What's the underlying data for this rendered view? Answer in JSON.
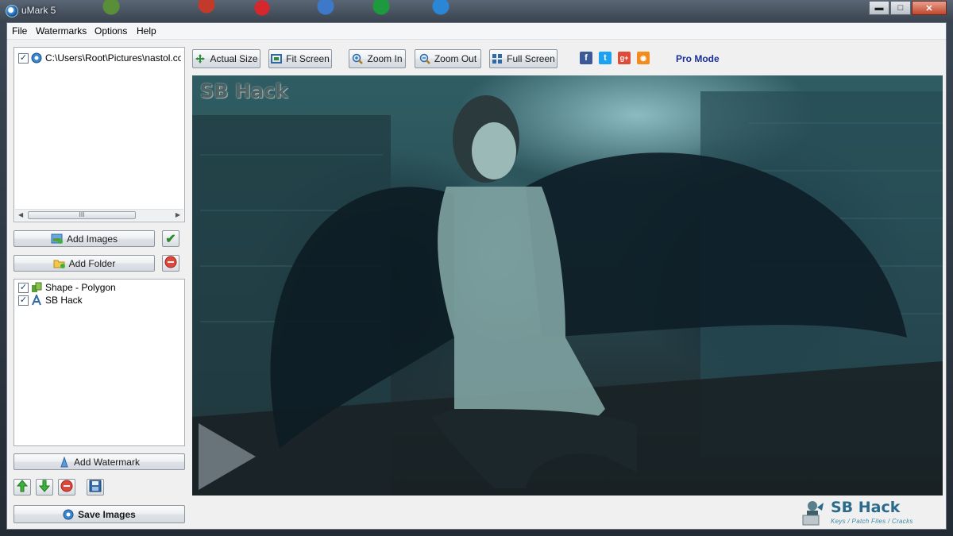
{
  "window": {
    "title": "uMark 5",
    "controls": {
      "minimize": "▬",
      "maximize": "□",
      "close": "✕"
    }
  },
  "menu": [
    "File",
    "Watermarks",
    "Options",
    "Help"
  ],
  "files": {
    "items": [
      {
        "checked": true,
        "path": "C:\\Users\\Root\\Pictures\\nastol.com.ua"
      }
    ],
    "scroll_grip": "III"
  },
  "buttons": {
    "add_images": "Add Images",
    "add_folder": "Add Folder",
    "add_watermark": "Add Watermark",
    "save_images": "Save Images"
  },
  "watermarks": [
    {
      "checked": true,
      "label": "Shape - Polygon",
      "icon": "shape-icon"
    },
    {
      "checked": true,
      "label": "SB Hack",
      "icon": "text-icon"
    }
  ],
  "toolbar": {
    "actual_size": "Actual Size",
    "fit_screen": "Fit Screen",
    "zoom_in": "Zoom In",
    "zoom_out": "Zoom Out",
    "full_screen": "Full Screen",
    "social": [
      {
        "name": "facebook-icon",
        "glyph": "f",
        "color": "#3b5998"
      },
      {
        "name": "twitter-icon",
        "glyph": "t",
        "color": "#1da1f2"
      },
      {
        "name": "google-plus-icon",
        "glyph": "g+",
        "color": "#dd4b39"
      },
      {
        "name": "rss-icon",
        "glyph": "◉",
        "color": "#f48c1d"
      }
    ],
    "pro_mode": "Pro Mode"
  },
  "preview": {
    "watermark_text": "SB Hack"
  },
  "branding": {
    "title": "SB Hack",
    "subtitle": "Keys / Patch Files / Cracks"
  }
}
